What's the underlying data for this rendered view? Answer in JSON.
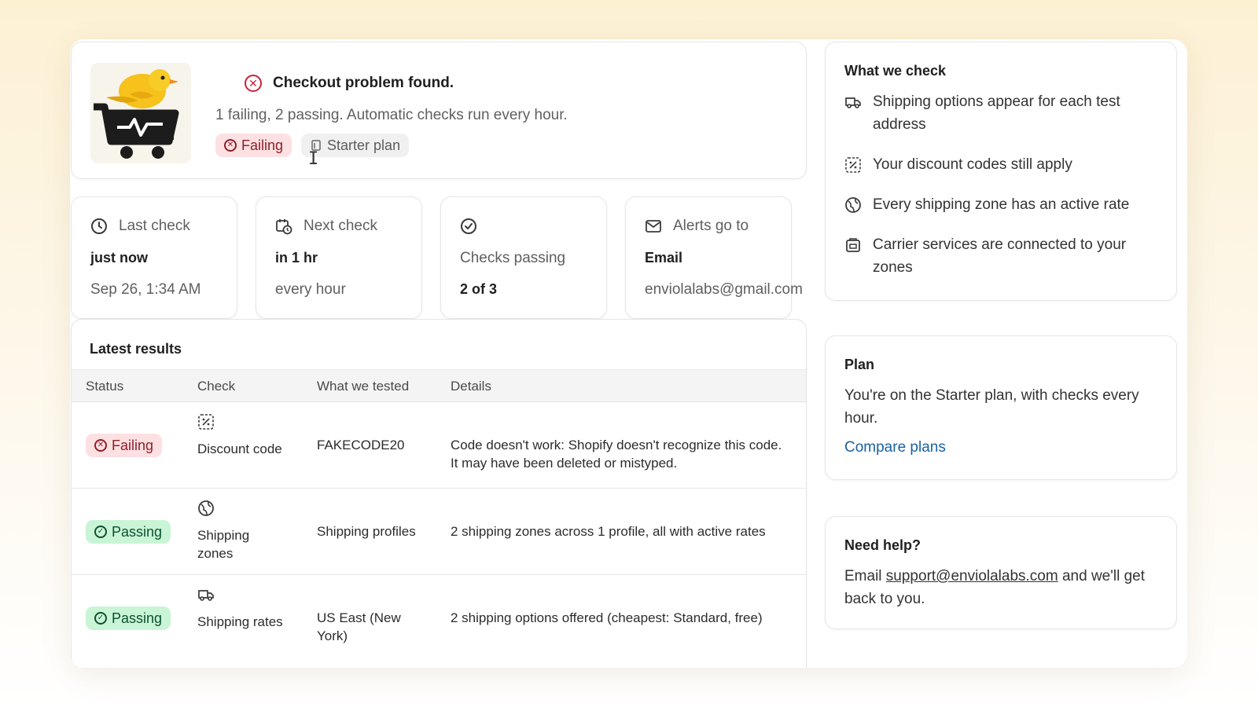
{
  "header": {
    "title": "Checkout problem found.",
    "subtitle": "1 failing, 2 passing. Automatic checks run every hour.",
    "status_badge": "Failing",
    "plan_badge": "Starter plan"
  },
  "stats": [
    {
      "label": "Last check",
      "value": "just now",
      "sub": "Sep 26, 1:34 AM",
      "icon": "clock-icon"
    },
    {
      "label": "Next check",
      "value": "in 1 hr",
      "sub": "every hour",
      "icon": "calendar-clock-icon"
    },
    {
      "label": "Checks passing",
      "value": "2 of 3",
      "sub": "",
      "icon": "check-circle-icon"
    },
    {
      "label": "Alerts go to",
      "value": "Email",
      "sub": "enviolalabs@gmail.com",
      "icon": "mail-icon"
    }
  ],
  "results": {
    "title": "Latest results",
    "columns": [
      "Status",
      "Check",
      "What we tested",
      "Details"
    ],
    "rows": [
      {
        "status": "Failing",
        "check": "Discount code",
        "icon": "discount-icon",
        "tested": "FAKECODE20",
        "details": "Code doesn't work: Shopify doesn't recognize this code. It may have been deleted or mistyped."
      },
      {
        "status": "Passing",
        "check": "Shipping zones",
        "icon": "globe-icon",
        "tested": "Shipping profiles",
        "details": "2 shipping zones across 1 profile, all with active rates"
      },
      {
        "status": "Passing",
        "check": "Shipping rates",
        "icon": "truck-icon",
        "tested": "US East (New York)",
        "details": "2 shipping options offered (cheapest: Standard, free)"
      }
    ]
  },
  "what_we_check": {
    "title": "What we check",
    "items": [
      {
        "label": "Shipping options appear for each test address",
        "icon": "truck-icon"
      },
      {
        "label": "Your discount codes still apply",
        "icon": "discount-icon"
      },
      {
        "label": "Every shipping zone has an active rate",
        "icon": "globe-icon"
      },
      {
        "label": "Carrier services are connected to your zones",
        "icon": "package-icon"
      }
    ]
  },
  "plan": {
    "title": "Plan",
    "text": "You're on the Starter plan, with checks every hour.",
    "link": "Compare plans"
  },
  "help": {
    "title": "Need help?",
    "prefix": "Email ",
    "email": "support@enviolalabs.com",
    "suffix": " and we'll get back to you."
  },
  "colors": {
    "failing_bg": "#fde0e2",
    "failing_fg": "#8e1f2b",
    "passing_bg": "#c9f5d6",
    "passing_fg": "#0c5132",
    "link": "#1961a6"
  }
}
